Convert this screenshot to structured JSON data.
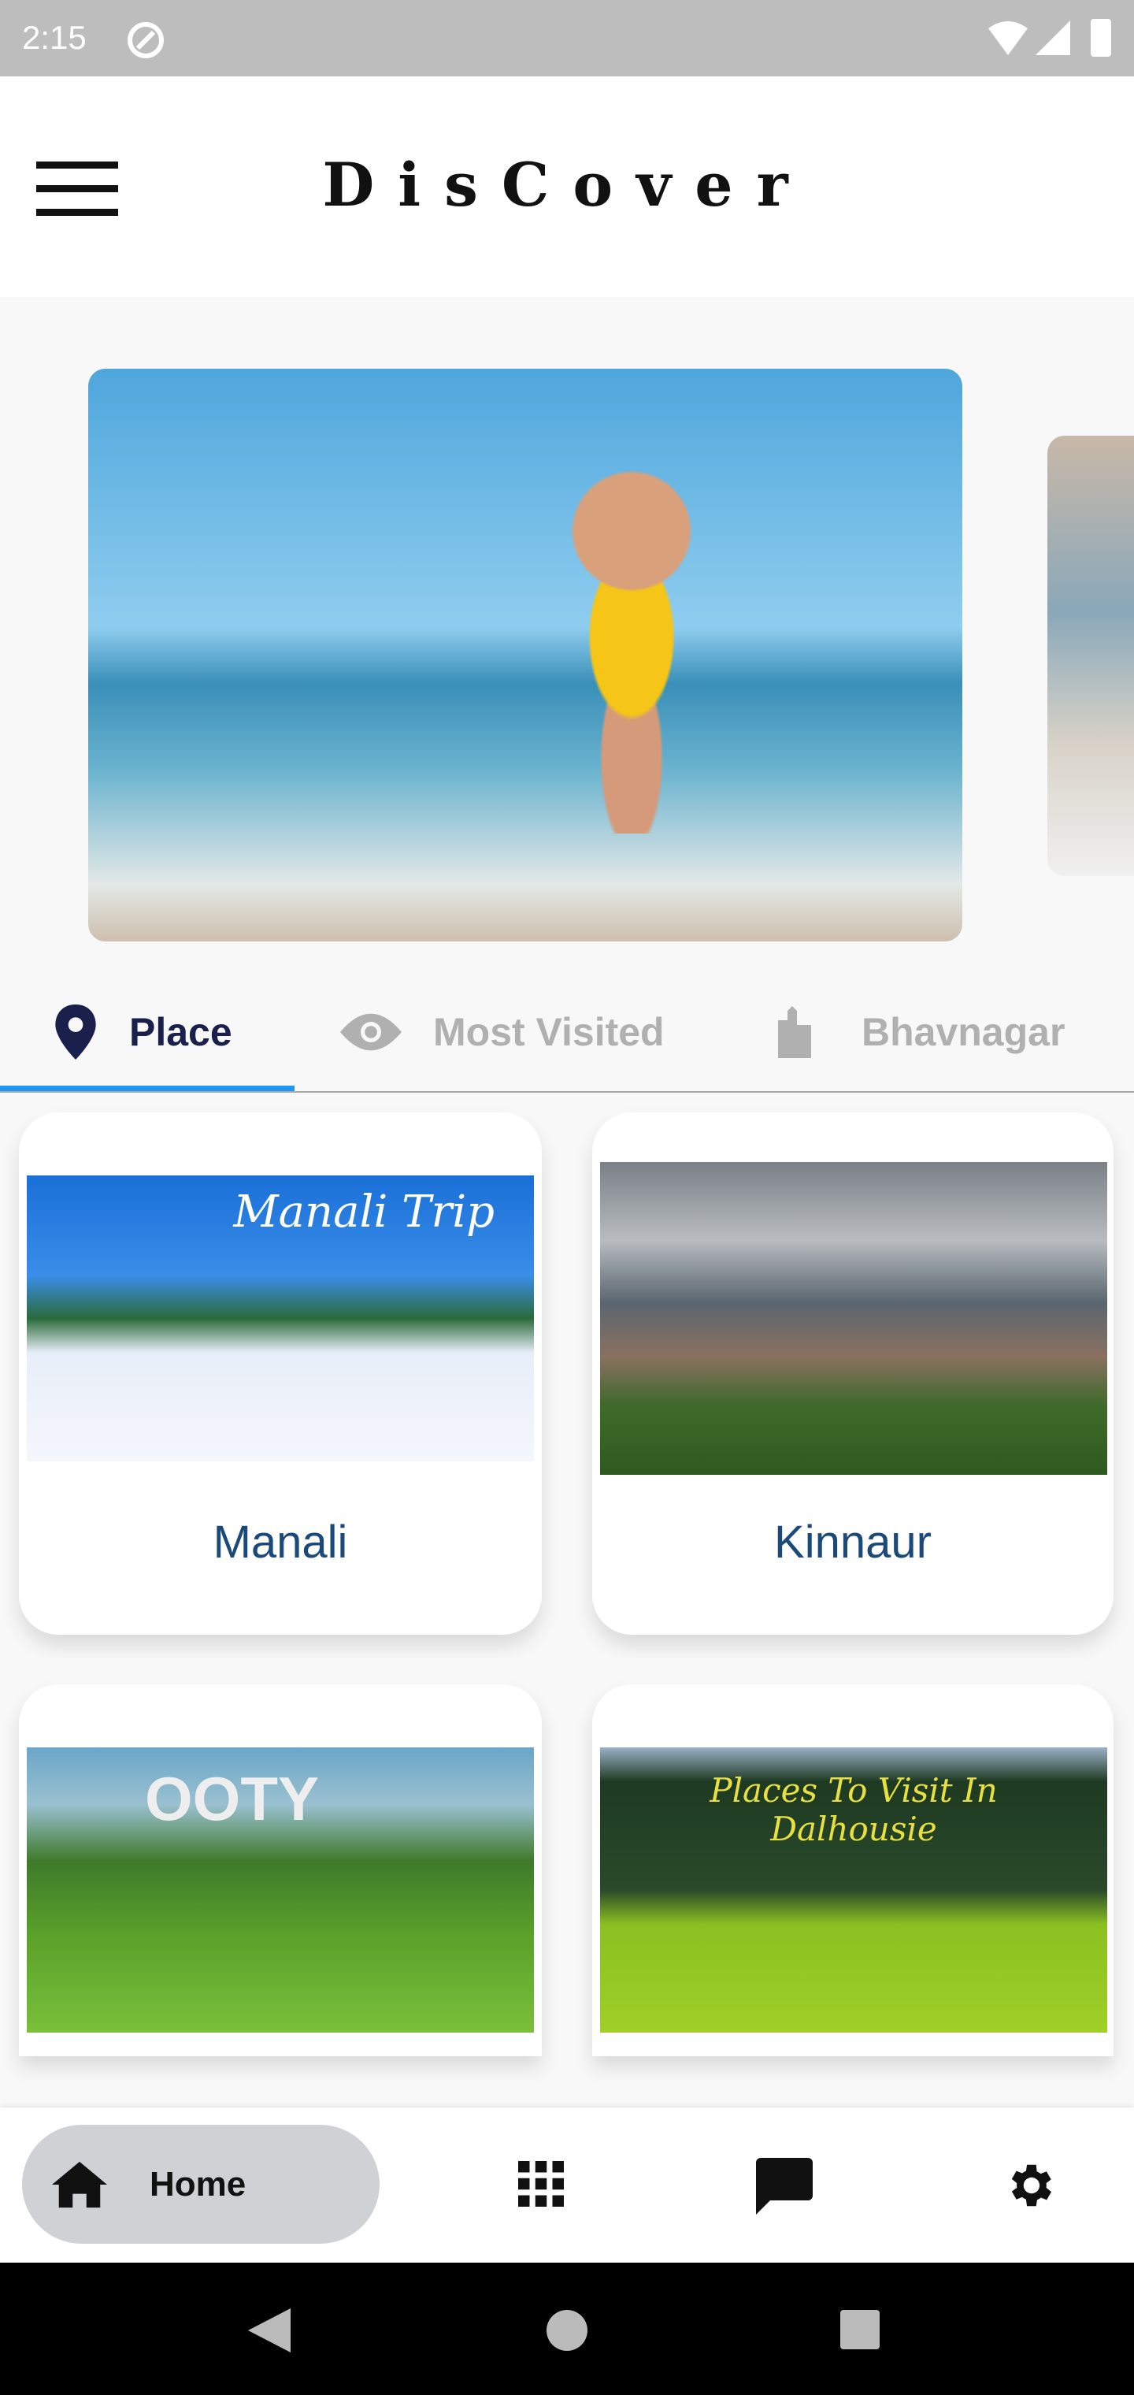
{
  "status_bar": {
    "time": "2:15"
  },
  "header": {
    "title": "DisCover"
  },
  "tabs": [
    {
      "label": "Place",
      "icon": "location-pin-icon",
      "active": true
    },
    {
      "label": "Most Visited",
      "icon": "eye-icon"
    },
    {
      "label": "Bhavnagar",
      "icon": "building-icon"
    }
  ],
  "places": [
    {
      "name": "Manali",
      "image_caption": "Manali Trip"
    },
    {
      "name": "Kinnaur"
    },
    {
      "name": "",
      "image_caption": "OOTY"
    },
    {
      "name": "",
      "image_caption": "Places To Visit In Dalhousie"
    }
  ],
  "bottom_nav": {
    "home_label": "Home",
    "items": [
      "home-icon",
      "grid-icon",
      "chat-icon",
      "settings-icon"
    ]
  },
  "colors": {
    "accent": "#2196f3",
    "active_tab": "#1b1f4b",
    "place_label": "#1b4a7a",
    "pill": "#d0d1d5"
  }
}
